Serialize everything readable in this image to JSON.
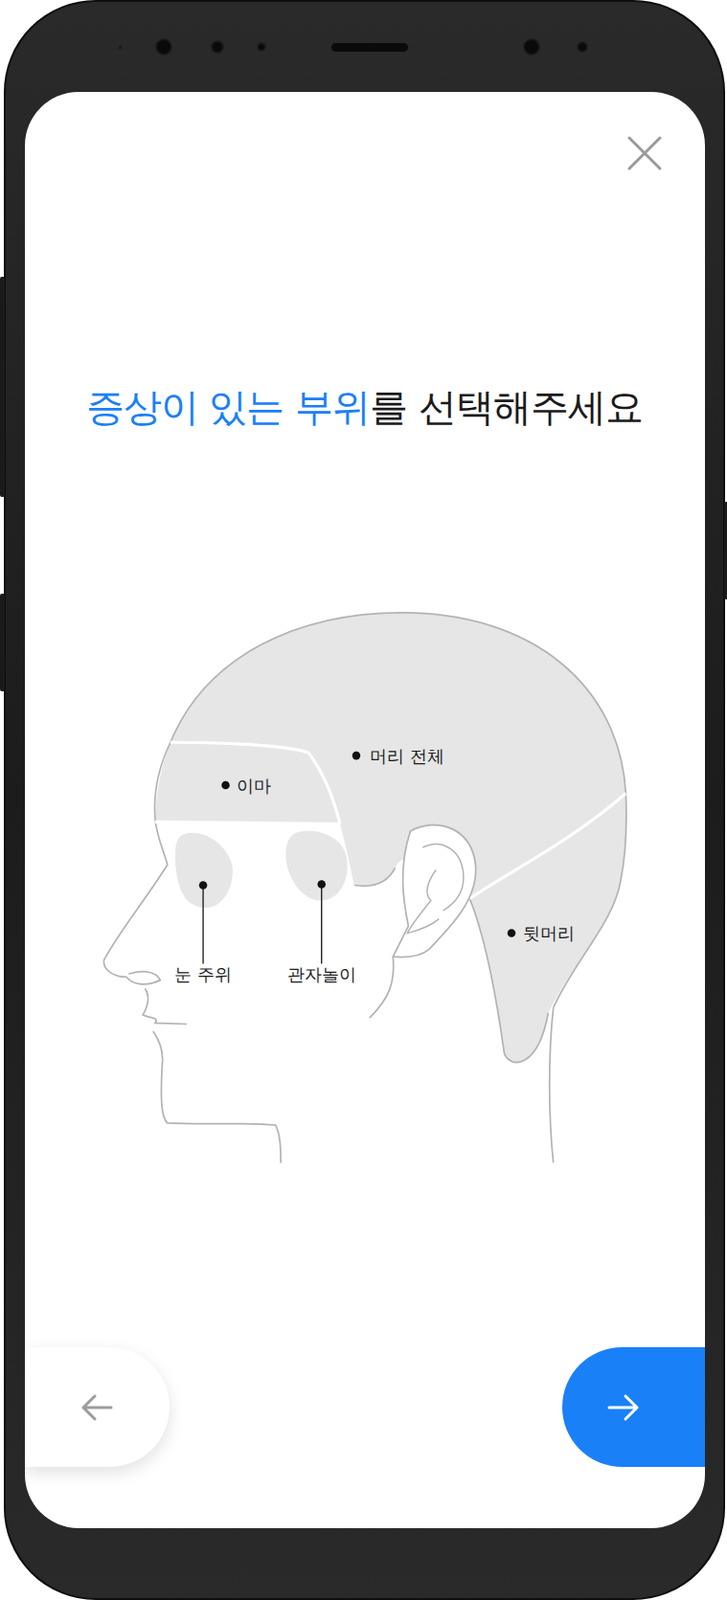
{
  "title": {
    "highlight": "증상이 있는 부위",
    "rest": "를 선택해주세요"
  },
  "regions": [
    {
      "label": "머리 전체",
      "selected": false
    },
    {
      "label": "이마",
      "selected": false
    },
    {
      "label": "눈 주위",
      "selected": false
    },
    {
      "label": "관자놀이",
      "selected": false
    },
    {
      "label": "뒷머리",
      "selected": false
    }
  ]
}
